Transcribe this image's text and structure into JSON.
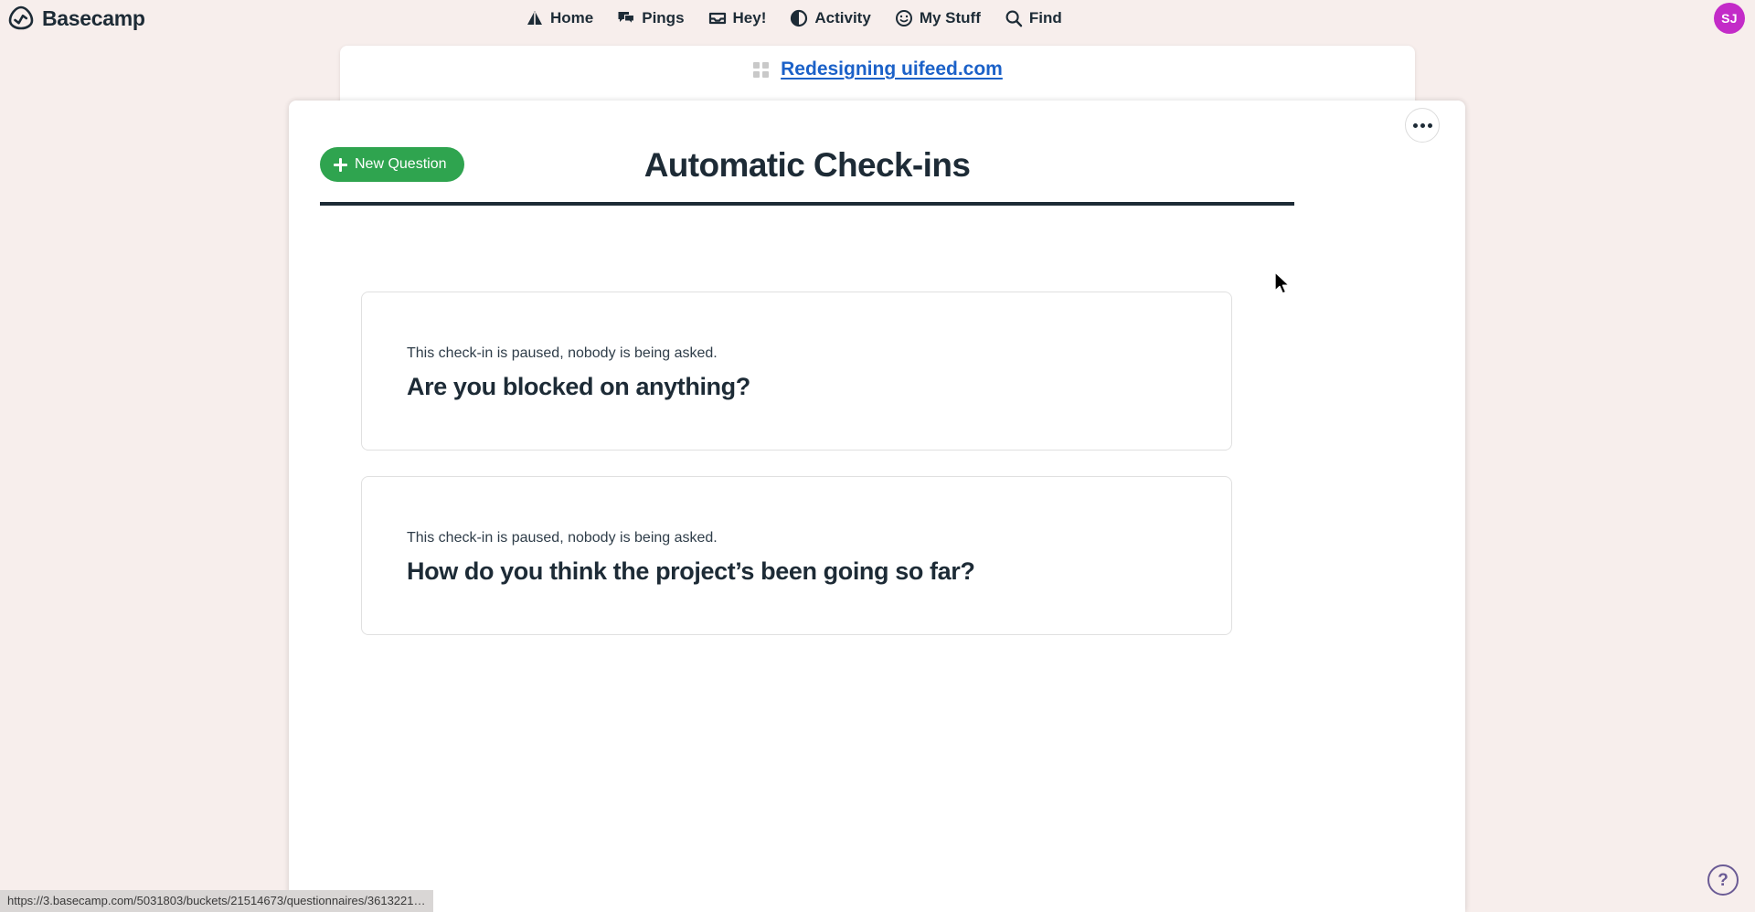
{
  "app": {
    "brand_name": "Basecamp",
    "brand_icon": "basecamp-logo-icon"
  },
  "nav": {
    "items": [
      {
        "label": "Home",
        "icon": "mountain-icon"
      },
      {
        "label": "Pings",
        "icon": "chat-bubbles-icon"
      },
      {
        "label": "Hey!",
        "icon": "inbox-tray-icon"
      },
      {
        "label": "Activity",
        "icon": "half-circle-icon"
      },
      {
        "label": "My Stuff",
        "icon": "smiley-face-icon"
      },
      {
        "label": "Find",
        "icon": "magnifier-icon"
      }
    ],
    "avatar_initials": "SJ",
    "avatar_color": "#c32bc8"
  },
  "project": {
    "name": "Redesigning uifeed.com",
    "icon": "grid-squares-icon",
    "link_color": "#1b61c8"
  },
  "toolbar": {
    "new_question_label": "New Question",
    "new_question_color": "#2fa44f",
    "overflow_menu_label": "More options",
    "overflow_icon": "ellipsis-icon"
  },
  "page": {
    "title": "Automatic Check-ins"
  },
  "questions": [
    {
      "status": "This check-in is paused, nobody is being asked.",
      "title": "Are you blocked on anything?"
    },
    {
      "status": "This check-in is paused, nobody is being asked.",
      "title": "How do you think the project’s been going so far?"
    }
  ],
  "help": {
    "label": "?",
    "color": "#6b5b95"
  },
  "statusbar": {
    "url": "https://3.basecamp.com/5031803/buckets/21514673/questionnaires/3613221…"
  }
}
